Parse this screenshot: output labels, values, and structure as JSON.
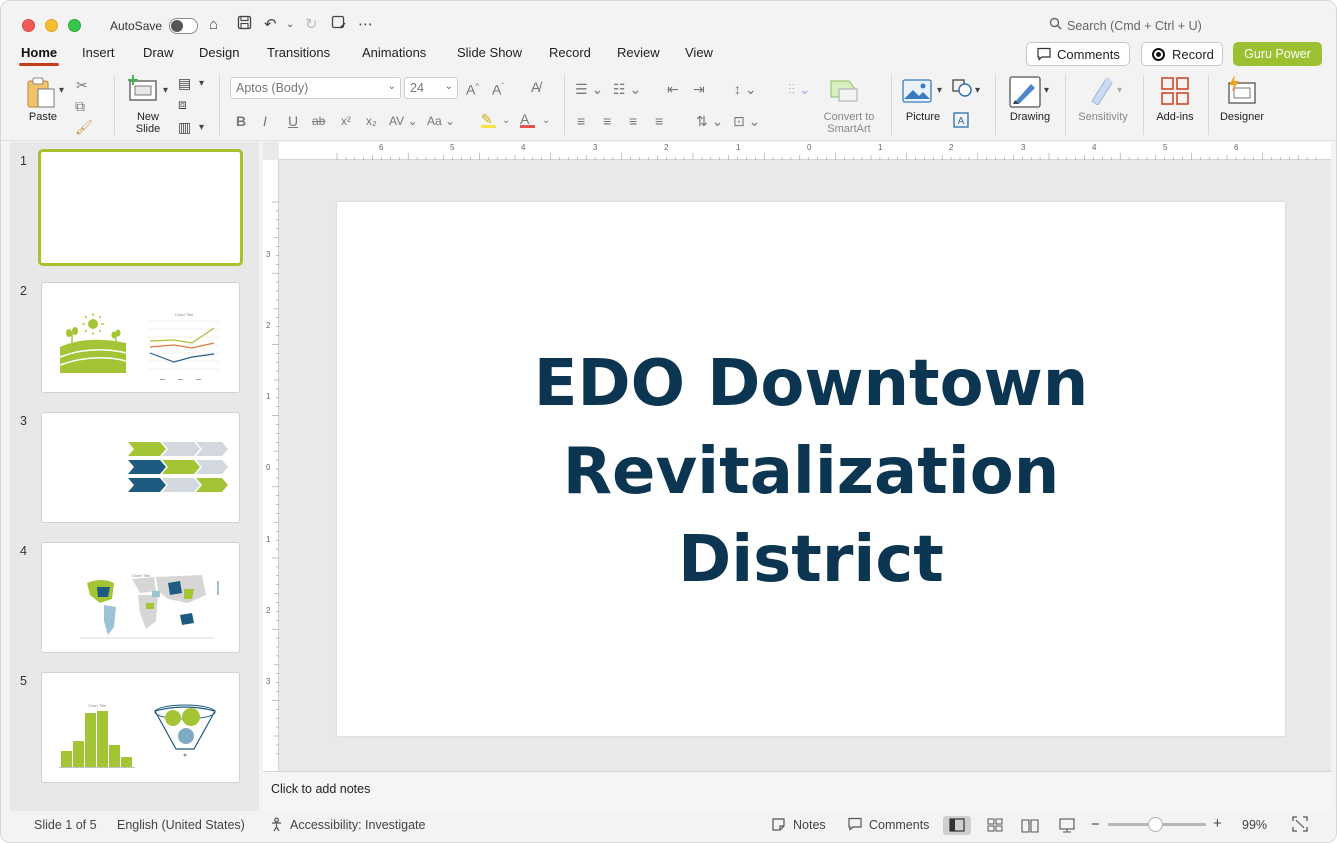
{
  "titlebar": {
    "autosave_label": "AutoSave",
    "search_placeholder": "Search (Cmd + Ctrl + U)"
  },
  "menu": {
    "tabs": [
      {
        "label": "Home"
      },
      {
        "label": "Insert"
      },
      {
        "label": "Draw"
      },
      {
        "label": "Design"
      },
      {
        "label": "Transitions"
      },
      {
        "label": "Animations"
      },
      {
        "label": "Slide Show"
      },
      {
        "label": "Record"
      },
      {
        "label": "Review"
      },
      {
        "label": "View"
      }
    ],
    "comments_label": "Comments",
    "record_label": "Record",
    "guru_label": "Guru Power"
  },
  "ribbon": {
    "paste_label": "Paste",
    "new_slide_label_1": "New",
    "new_slide_label_2": "Slide",
    "font_name": "Aptos (Body)",
    "font_size": "24",
    "convert_label_1": "Convert to",
    "convert_label_2": "SmartArt",
    "picture_label": "Picture",
    "drawing_label": "Drawing",
    "sensitivity_label": "Sensitivity",
    "addins_label": "Add-ins",
    "designer_label": "Designer"
  },
  "thumbnails": [
    {
      "number": "1"
    },
    {
      "number": "2",
      "caption": "Chart Title"
    },
    {
      "number": "3"
    },
    {
      "number": "4",
      "caption": "Chart Title"
    },
    {
      "number": "5",
      "caption": "Chart Title"
    }
  ],
  "ruler": {
    "h_labels": [
      "6",
      "5",
      "4",
      "3",
      "2",
      "1",
      "0",
      "1",
      "2",
      "3",
      "4",
      "5",
      "6"
    ],
    "v_labels": [
      "3",
      "2",
      "1",
      "0",
      "1",
      "2",
      "3"
    ]
  },
  "slide": {
    "title_lines": [
      "EDO Downtown",
      "Revitalization",
      "District"
    ]
  },
  "notes_placeholder": "Click to add notes",
  "status": {
    "slide_info": "Slide 1 of 5",
    "language": "English (United States)",
    "accessibility": "Accessibility: Investigate",
    "notes_label": "Notes",
    "comments_label": "Comments",
    "zoom": "99%"
  },
  "colors": {
    "accent": "#c43e1c",
    "lime": "#9cc130",
    "navy": "#0b3550"
  }
}
